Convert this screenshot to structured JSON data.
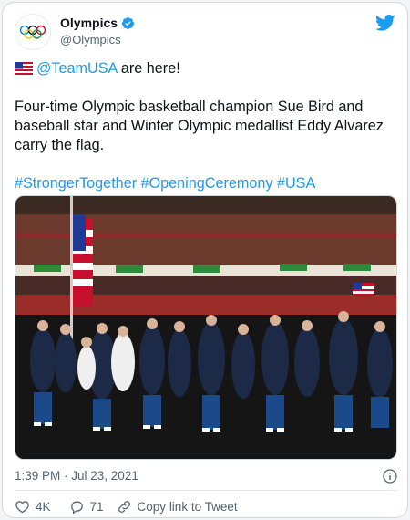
{
  "tweet": {
    "display_name": "Olympics",
    "handle": "@Olympics",
    "mention": "@TeamUSA",
    "line1_rest": " are here!",
    "body_lines": [
      "Four-time Olympic basketball champion Sue Bird and",
      "baseball star and Winter Olympic medallist Eddy Alvarez",
      "carry the flag."
    ],
    "hashtags": "#StrongerTogether #OpeningCeremony #USA",
    "timestamp": "1:39 PM · Jul 23, 2021",
    "likes": "4K",
    "replies": "71",
    "copy_link": "Copy link to Tweet"
  },
  "icons": {
    "logo": "olympic-rings-icon",
    "verified": "verified-badge-icon",
    "brand": "twitter-bird-icon",
    "flag": "us-flag-emoji",
    "info": "info-icon",
    "like": "heart-icon",
    "reply": "reply-bubble-icon",
    "copy": "link-icon"
  },
  "colors": {
    "accent": "#1d9bf0",
    "text": "#0f1419",
    "muted": "#536471",
    "border": "#cfd9de"
  }
}
